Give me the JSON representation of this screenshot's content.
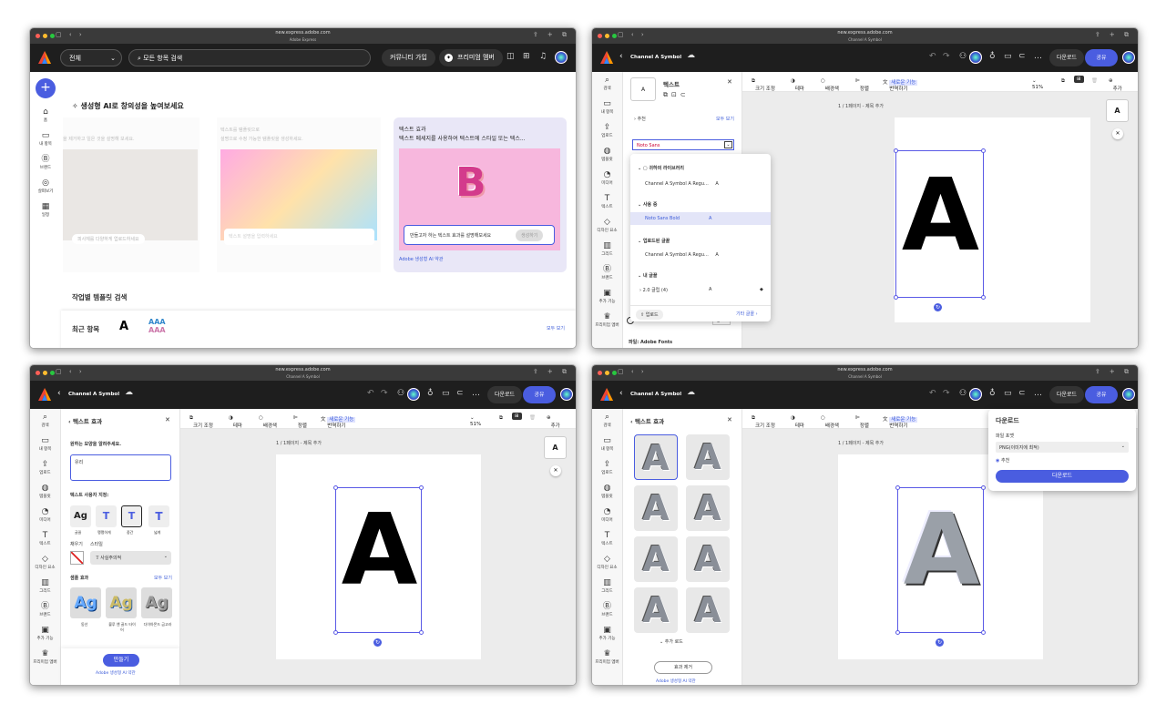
{
  "browser": {
    "url": "new.express.adobe.com",
    "tab1": "Adobe Express",
    "tab2": "Channel A Symbol"
  },
  "brand": {
    "accent": "#4a5de0",
    "dark": "#1e1e1e"
  },
  "home": {
    "filter": "전체",
    "search_placeholder": "모든 항목 검색",
    "community": "커뮤니티 가입",
    "premium": "프리미엄 멤버",
    "headline": "생성형 AI로 창의성을 높여보세요",
    "card1_text": "을 제거하고 일은 것을 설명해 보세요.",
    "card1_btn": "피사체를 다양하게 업로드하세요",
    "card2_title": "텍스트를 템플릿으로",
    "card2_text": "설명으로 수정 가능한 템플릿을 생성하세요.",
    "card2_input": "텍스트 설명을 입력하세요",
    "card3_title": "텍스트 효과",
    "card3_sub": "텍스트 메세지를 사용하여 텍스트에 스타일 또는 텍스...",
    "card3_input": "만들고자 하는 텍스트 효과를 설명해보세요",
    "card3_btn": "생성하기",
    "card3_terms": "Adobe 생성형 AI 약관",
    "templates": "작업별 템플릿 검색",
    "recent": "최근 항목",
    "recent_a": "A",
    "recent_aaa": "AAA",
    "see_all": "모두 보기",
    "rail": [
      "홈",
      "내 항목",
      "브랜드",
      "살펴보기",
      "일정"
    ]
  },
  "editor": {
    "doc_title": "Channel A Symbol",
    "download": "다운로드",
    "share": "공유",
    "toolbar": [
      "크기 조정",
      "테마",
      "배경색",
      "정렬",
      "번역하기"
    ],
    "new_badge": "새로운 기능",
    "zoom": "51%",
    "add": "추가",
    "page_label": "1 / 1페이지 - 제목 추가",
    "glyph": "A",
    "rail": [
      "검색",
      "내 항목",
      "업로드",
      "템플릿",
      "미디어",
      "텍스트",
      "디자인 요소",
      "그리드",
      "브랜드",
      "추가 기능",
      "프리미엄 멤버"
    ]
  },
  "text_panel": {
    "title": "텍스트",
    "recommend": "추천",
    "see_all": "모두 보기",
    "font_value": "Noto Sans",
    "libraries": "귀하의 라이브러리",
    "lib_font": "Channel A Symbol A Regu...",
    "in_use": "사용 중",
    "in_use_font": "Noto Sans Bold",
    "uploaded": "업로드된 글꼴",
    "uploaded_font": "Channel A Symbol A Regu...",
    "my_fonts": "내 글꼴",
    "font_size": "2.0 글립 (4)",
    "upload_btn": "업로드",
    "other": "기타 글꼴",
    "slider_val": "0",
    "footer": "Adobe Fonts"
  },
  "effect_panel": {
    "title": "텍스트 효과",
    "prompt_label": "원하는 모양을 알려주세요.",
    "prompt_value": "유리",
    "custom": "텍스트 사용자 지정:",
    "styles": [
      "글꼴",
      "팽팽하게",
      "중간",
      "넓게"
    ],
    "fill": "채우기",
    "outline": "스타일",
    "style_select": "사실주의적",
    "samples": "샘플 효과",
    "samples_all": "모두 보기",
    "sample_names": [
      "동선",
      "블루 앤 골드 타이어",
      "다이아몬드 금고라"
    ],
    "make": "만들기",
    "terms": "Adobe 생성형 AI 약관",
    "more": "추가 로드",
    "remove": "효과 제거"
  },
  "download_panel": {
    "title": "다운로드",
    "file_format": "파일 포맷",
    "format_value": "PNG(이미지에 최적)",
    "recommend": "추천",
    "button": "다운로드"
  }
}
